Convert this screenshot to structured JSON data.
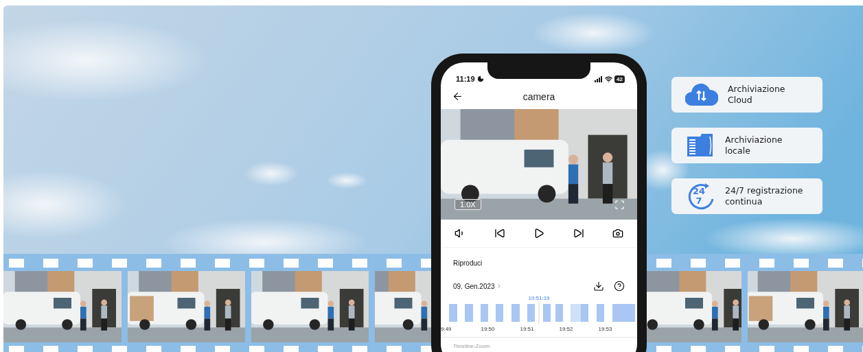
{
  "phone": {
    "status_bar": {
      "time": "11:19",
      "battery": "42"
    },
    "header": {
      "title": "camera"
    },
    "video": {
      "kind": "picture",
      "zoom": "1.0X"
    },
    "playback": {
      "title": "Riproduci",
      "date": "09. Gen.2023"
    },
    "timeline": {
      "current_time": "19:51:19",
      "ticks": [
        "9:49",
        "19:50",
        "19:51",
        "19:52",
        "19:53"
      ],
      "zoom_label": "Timeline-Zoom"
    }
  },
  "features": [
    {
      "kind": "cloud",
      "lines": [
        "Archiviazione",
        "Cloud"
      ]
    },
    {
      "kind": "card",
      "lines": [
        "Archiviazione",
        "locale"
      ]
    },
    {
      "kind": "clock",
      "lines": [
        "24/7 registrazione",
        "continua"
      ],
      "icon_text": [
        "24",
        "7"
      ]
    }
  ]
}
